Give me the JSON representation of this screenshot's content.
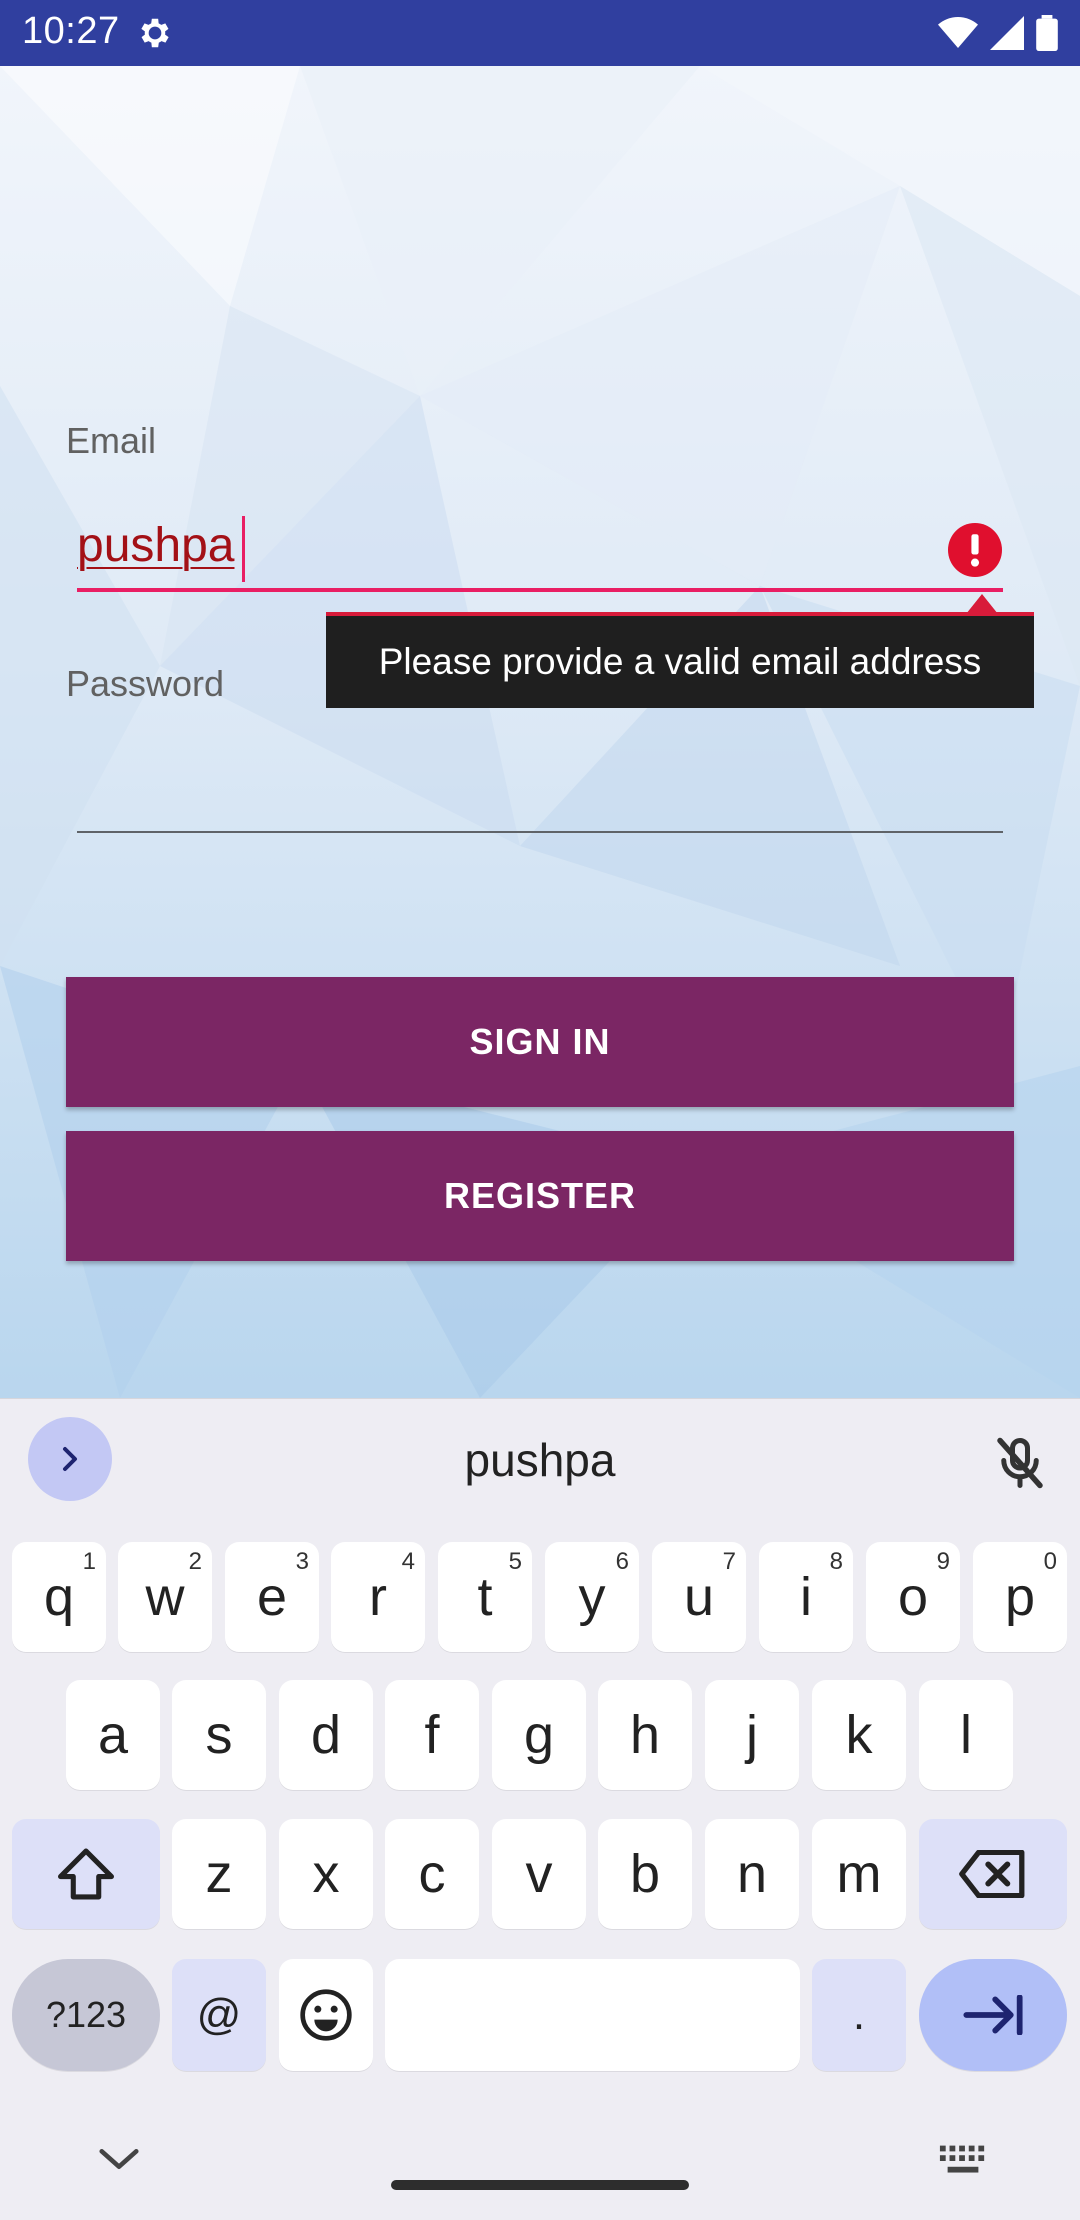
{
  "status_bar": {
    "time": "10:27",
    "icons": [
      "settings-gear-icon",
      "wifi-icon",
      "signal-icon",
      "battery-icon"
    ],
    "bg_color": "#303f9f"
  },
  "login_form": {
    "email_label": "Email",
    "email_value": "pushpa",
    "email_error": "Please provide a valid email address",
    "password_label": "Password",
    "password_value": "",
    "sign_in_label": "SIGN IN",
    "register_label": "REGISTER",
    "accent_color": "#e91e63",
    "button_color": "#7b2664"
  },
  "keyboard": {
    "suggestion": "pushpa",
    "row1": [
      {
        "label": "q",
        "hint": "1"
      },
      {
        "label": "w",
        "hint": "2"
      },
      {
        "label": "e",
        "hint": "3"
      },
      {
        "label": "r",
        "hint": "4"
      },
      {
        "label": "t",
        "hint": "5"
      },
      {
        "label": "y",
        "hint": "6"
      },
      {
        "label": "u",
        "hint": "7"
      },
      {
        "label": "i",
        "hint": "8"
      },
      {
        "label": "o",
        "hint": "9"
      },
      {
        "label": "p",
        "hint": "0"
      }
    ],
    "row2": [
      "a",
      "s",
      "d",
      "f",
      "g",
      "h",
      "j",
      "k",
      "l"
    ],
    "row3": [
      "z",
      "x",
      "c",
      "v",
      "b",
      "n",
      "m"
    ],
    "symbols_label": "?123",
    "at_label": "@",
    "period_label": "."
  }
}
